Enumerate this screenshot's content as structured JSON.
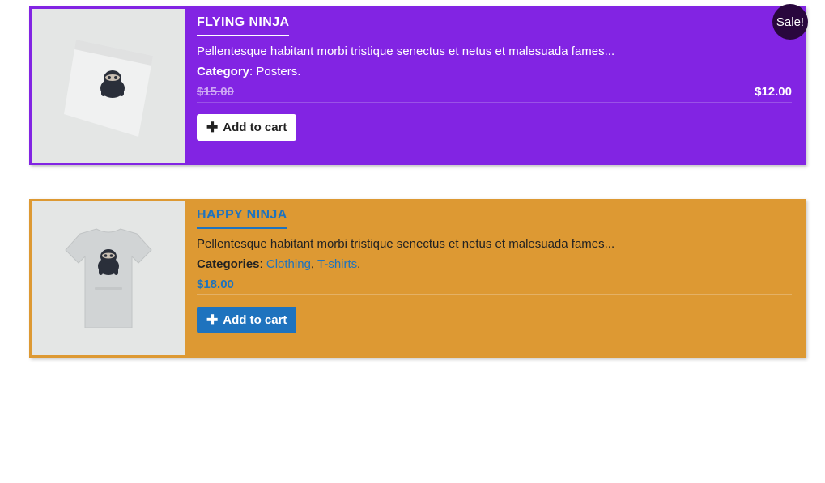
{
  "ui": {
    "sale_badge": "Sale!",
    "add_to_cart": "Add to cart"
  },
  "products": [
    {
      "title": "FLYING NINJA",
      "description": "Pellentesque habitant morbi tristique senectus et netus et malesuada fames...",
      "category_label": "Category",
      "categories_text": "Posters",
      "old_price": "$15.00",
      "price": "$12.00",
      "on_sale": true
    },
    {
      "title": "HAPPY NINJA",
      "description": "Pellentesque habitant morbi tristique senectus et netus et malesuada fames...",
      "category_label": "Categories",
      "categories": [
        "Clothing",
        "T-shirts"
      ],
      "price": "$18.00"
    }
  ]
}
